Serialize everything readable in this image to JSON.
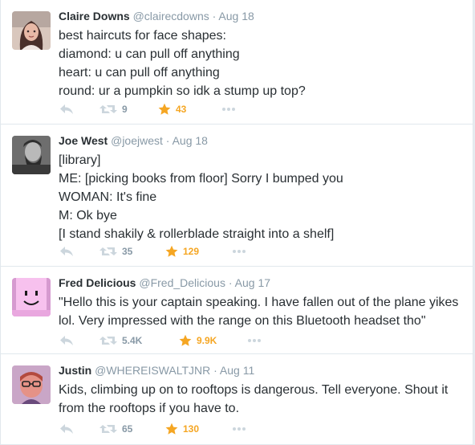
{
  "tweets": [
    {
      "fullname": "Claire Downs",
      "handle": "@clairecdowns",
      "separator": "·",
      "time": "Aug 18",
      "lines": [
        "best haircuts for face shapes:",
        "diamond: u can pull off anything",
        "heart: u can pull off anything",
        "round: ur a pumpkin so idk a stump up top?"
      ],
      "retweets": "9",
      "favorites": "43"
    },
    {
      "fullname": "Joe West",
      "handle": "@joejwest",
      "separator": "·",
      "time": "Aug 18",
      "lines": [
        "[library]",
        "ME: [picking books from floor] Sorry I bumped you",
        "WOMAN: It's fine",
        "M: Ok bye",
        "[I stand shakily & rollerblade straight into a shelf]"
      ],
      "retweets": "35",
      "favorites": "129"
    },
    {
      "fullname": "Fred Delicious",
      "handle": "@Fred_Delicious",
      "separator": "·",
      "time": "Aug 17",
      "lines": [
        "\"Hello this is your captain speaking. I have fallen out of the plane yikes",
        "lol. Very impressed with the range on this Bluetooth headset tho\""
      ],
      "retweets": "5.4K",
      "favorites": "9.9K"
    },
    {
      "fullname": "Justin",
      "handle": "@WHEREISWALTJNR",
      "separator": "·",
      "time": "Aug 11",
      "lines": [
        "Kids, climbing up on to rooftops is dangerous. Tell everyone. Shout it",
        "from the rooftops if you have to."
      ],
      "retweets": "65",
      "favorites": "130"
    }
  ],
  "icons": {
    "reply": "reply-icon",
    "retweet": "retweet-icon",
    "favorite": "star-icon",
    "more": "more-icon"
  },
  "colors": {
    "name": "#292f33",
    "muted": "#8899a6",
    "favorite": "#f5a623",
    "border": "#e1e8ed",
    "action_icon": "#ccd6dd"
  }
}
